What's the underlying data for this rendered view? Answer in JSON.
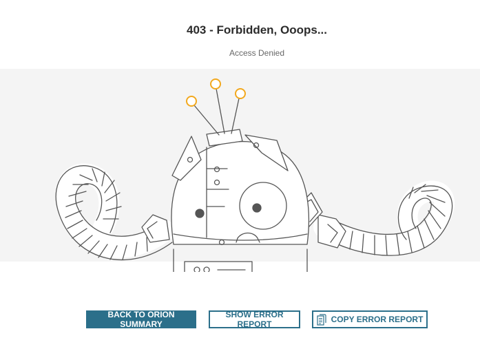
{
  "page": {
    "title": "403 - Forbidden, Ooops...",
    "subtitle": "Access Denied"
  },
  "illustration": {
    "icon": "broken-robot-illustration",
    "stroke_color": "#555555",
    "antenna_color": "#f2a81d",
    "background_color": "#f4f4f4"
  },
  "buttons": {
    "back_label": "BACK TO ORION SUMMARY",
    "show_label": "SHOW ERROR REPORT",
    "copy_label": "COPY ERROR REPORT",
    "copy_icon": "document-copy-icon"
  },
  "colors": {
    "accent": "#2b6f8a",
    "title": "#2b2b2b",
    "subtitle": "#666666"
  }
}
